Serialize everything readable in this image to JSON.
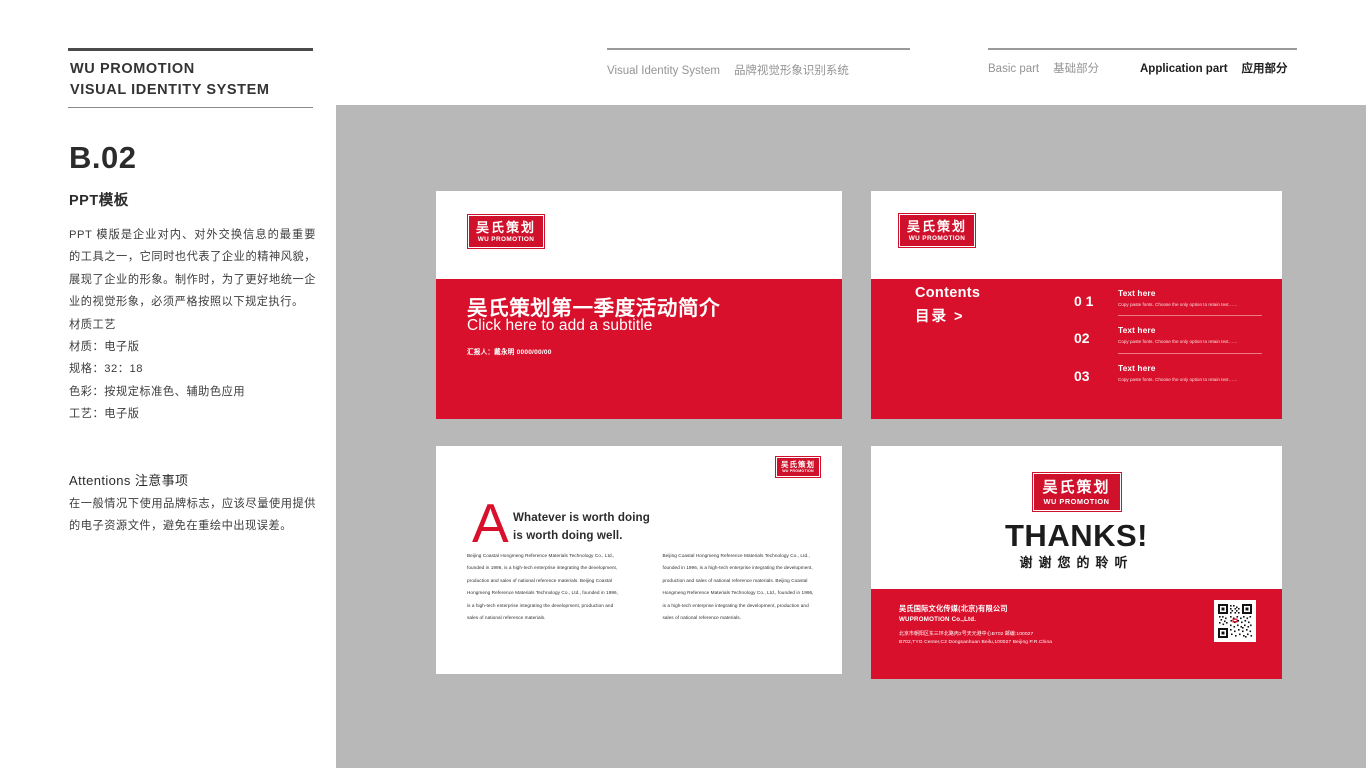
{
  "header": {
    "brand_line1": "WU PROMOTION",
    "brand_line2": "VISUAL IDENTITY SYSTEM",
    "nav": {
      "vis_en": "Visual Identity System",
      "vis_cn": "品牌视觉形象识别系统",
      "basic_en": "Basic part",
      "basic_cn": "基础部分",
      "app_en": "Application part",
      "app_cn": "应用部分"
    }
  },
  "sidebar": {
    "code": "B.02",
    "subtitle": "PPT模板",
    "body": "PPT 模版是企业对内、对外交换信息的最重要的工具之一，它同时也代表了企业的精神风貌，展现了企业的形象。制作时，为了更好地统一企业的视觉形象，必须严格按照以下规定执行。",
    "specs": [
      "材质工艺",
      "材质：电子版",
      "规格：32：18",
      "色彩：按规定标准色、辅助色应用",
      "工艺：电子版"
    ],
    "attentions_title": "Attentions 注意事项",
    "attentions_body": "在一般情况下使用品牌标志，应该尽量使用提供的电子资源文件，避免在重绘中出现误差。"
  },
  "logo": {
    "cn": "吴氏策划",
    "en": "WU PROMOTION",
    "color": "#d0112b"
  },
  "colors": {
    "brand_red": "#d8102b",
    "panel_gray": "#b8b8b8",
    "ink": "#2b2b2b"
  },
  "slides": {
    "title": {
      "heading": "吴氏策划第一季度活动简介",
      "subtitle": "Click here to add a subtitle",
      "meta": "汇报人：戴永明  0000/00/00"
    },
    "contents": {
      "label_en": "Contents",
      "label_cn": "目录  >",
      "items": [
        {
          "num": "0 1",
          "heading": "Text here",
          "text": "Copy paste fonts. Choose the only option to retain text……"
        },
        {
          "num": "02",
          "heading": "Text here",
          "text": "Copy paste fonts. Choose the only option to retain text……"
        },
        {
          "num": "03",
          "heading": "Text here",
          "text": "Copy paste fonts. Choose the only option to retain text……"
        }
      ]
    },
    "quote": {
      "drop_cap": "A",
      "line1": "Whatever is worth doing",
      "line2": "is worth doing well.",
      "paragraph": "Beijing Coastal Hongmeng Reference Materials Technology Co., Ltd., founded in 1996, is a high-tech enterprise integrating the development, production and sales of national reference materials. Beijing Coastal Hongmeng Reference Materials Technology Co., Ltd., founded in 1996, is a high-tech enterprise integrating the development, production and sales of national reference materials."
    },
    "thanks": {
      "heading": "THANKS!",
      "subheading": "谢谢您的聆听",
      "company_cn": "吴氏国际文化传媒(北京)有限公司",
      "company_en": "WUPROMOTION Co.,Ltd.",
      "address_cn": "北京市朝阳区东三环北路丙2号天元港中心B702 邮编:100027",
      "address_en": "B702,TYG Center,C2 Dongsanhuan Beilu,100027 Beijing P.R.China"
    }
  }
}
